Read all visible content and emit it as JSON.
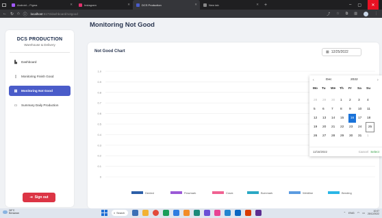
{
  "browser": {
    "tabs": [
      {
        "label": "Android – Figma",
        "icon": "figma-icon",
        "color": "#a259ff",
        "active": false
      },
      {
        "label": "Instagram",
        "icon": "instagram-icon",
        "color": "#e1306c",
        "active": false
      },
      {
        "label": "DCS Production",
        "icon": "app-icon",
        "color": "#4a5cc9",
        "active": true
      },
      {
        "label": "New tab",
        "icon": "chrome-icon",
        "color": "#888888",
        "active": false
      }
    ],
    "new_tab": "+",
    "url_host": "localhost",
    "url_path": ":5173/dashboard/notgood"
  },
  "sidebar": {
    "title": "DCS PRODUCTION",
    "subtitle": "Warehouse & Delivery",
    "items": [
      {
        "label": "Dashboard",
        "icon": "dashboard-icon",
        "active": false
      },
      {
        "label": "Monitoring Finish Good",
        "icon": "clipboard-icon",
        "active": false
      },
      {
        "label": "Monitoring Not Good",
        "icon": "list-icon",
        "active": true
      },
      {
        "label": "Summary Daily Production",
        "icon": "summary-icon",
        "active": false
      }
    ],
    "signout": "Sign out"
  },
  "main": {
    "page_title": "Monitoring Not Good",
    "card_title": "Not Good Chart",
    "date_value": "12/25/2022"
  },
  "chart_data": {
    "type": "bar",
    "title": "",
    "yticks": [
      "1.0",
      "0.9",
      "0.8",
      "0.7",
      "0.6",
      "0.5",
      "0.4",
      "0.3",
      "0.2",
      "0.1",
      "0"
    ],
    "ylim": [
      0,
      1
    ],
    "categories": [],
    "series": [
      {
        "name": "Dented",
        "color": "#2c5fa8",
        "values": []
      },
      {
        "name": "Flowmark",
        "color": "#9b59d6",
        "values": []
      },
      {
        "name": "Crack",
        "color": "#f06292",
        "values": []
      },
      {
        "name": "Burnmark",
        "color": "#2aa8c4",
        "values": []
      },
      {
        "name": "Weldline",
        "color": "#5b9be0",
        "values": []
      },
      {
        "name": "Bending",
        "color": "#29b6e6",
        "values": []
      }
    ],
    "legend": "bottom",
    "grid": true
  },
  "datepicker": {
    "prev": "‹",
    "next": "›",
    "month": "Dec",
    "year": "2022",
    "weekdays": [
      "Mo",
      "Tu",
      "We",
      "Th",
      "Fr",
      "Sa",
      "Su"
    ],
    "days": [
      {
        "d": "28",
        "s": "muted"
      },
      {
        "d": "29",
        "s": "muted"
      },
      {
        "d": "30",
        "s": "muted"
      },
      {
        "d": "1",
        "s": ""
      },
      {
        "d": "2",
        "s": ""
      },
      {
        "d": "3",
        "s": ""
      },
      {
        "d": "4",
        "s": ""
      },
      {
        "d": "5",
        "s": ""
      },
      {
        "d": "6",
        "s": ""
      },
      {
        "d": "7",
        "s": ""
      },
      {
        "d": "8",
        "s": ""
      },
      {
        "d": "9",
        "s": ""
      },
      {
        "d": "10",
        "s": ""
      },
      {
        "d": "11",
        "s": ""
      },
      {
        "d": "12",
        "s": ""
      },
      {
        "d": "13",
        "s": ""
      },
      {
        "d": "14",
        "s": ""
      },
      {
        "d": "15",
        "s": ""
      },
      {
        "d": "16",
        "s": "sel"
      },
      {
        "d": "17",
        "s": ""
      },
      {
        "d": "18",
        "s": ""
      },
      {
        "d": "19",
        "s": ""
      },
      {
        "d": "20",
        "s": ""
      },
      {
        "d": "21",
        "s": ""
      },
      {
        "d": "22",
        "s": ""
      },
      {
        "d": "23",
        "s": ""
      },
      {
        "d": "24",
        "s": ""
      },
      {
        "d": "25",
        "s": "today"
      },
      {
        "d": "26",
        "s": ""
      },
      {
        "d": "27",
        "s": ""
      },
      {
        "d": "28",
        "s": ""
      },
      {
        "d": "29",
        "s": ""
      },
      {
        "d": "30",
        "s": ""
      },
      {
        "d": "31",
        "s": ""
      },
      {
        "d": "1",
        "s": "muted"
      }
    ],
    "footer_value": "12/16/2022",
    "cancel": "Cancel",
    "select": "Select"
  },
  "taskbar": {
    "temp": "28°C",
    "weather": "Berawan",
    "search": "Search",
    "lang": "ENG",
    "time": "10:07",
    "date": "25/12/2022"
  }
}
